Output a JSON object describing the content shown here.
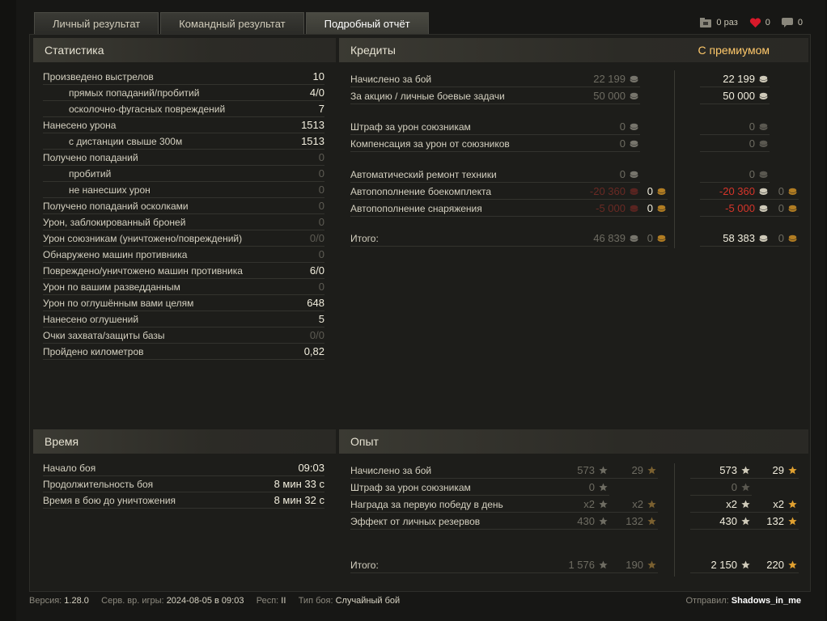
{
  "tabs": [
    "Личный результат",
    "Командный результат",
    "Подробный отчёт"
  ],
  "top": {
    "views": "0 раз",
    "likes": "0",
    "comments": "0"
  },
  "stats": {
    "title": "Статистика",
    "rows": [
      {
        "label": "Произведено выстрелов",
        "value": "10",
        "indent": false,
        "dim": false
      },
      {
        "label": "прямых попаданий/пробитий",
        "value": "4/0",
        "indent": true,
        "dim": false
      },
      {
        "label": "осколочно-фугасных повреждений",
        "value": "7",
        "indent": true,
        "dim": false
      },
      {
        "label": "Нанесено урона",
        "value": "1513",
        "indent": false,
        "dim": false
      },
      {
        "label": "с дистанции свыше 300м",
        "value": "1513",
        "indent": true,
        "dim": false
      },
      {
        "label": "Получено попаданий",
        "value": "0",
        "indent": false,
        "dim": true
      },
      {
        "label": "пробитий",
        "value": "0",
        "indent": true,
        "dim": true
      },
      {
        "label": "не нанесших урон",
        "value": "0",
        "indent": true,
        "dim": true
      },
      {
        "label": "Получено попаданий осколками",
        "value": "0",
        "indent": false,
        "dim": true
      },
      {
        "label": "Урон, заблокированный броней",
        "value": "0",
        "indent": false,
        "dim": true
      },
      {
        "label": "Урон союзникам (уничтожено/повреждений)",
        "value": "0/0",
        "indent": false,
        "dim": true
      },
      {
        "label": "Обнаружено машин противника",
        "value": "0",
        "indent": false,
        "dim": true
      },
      {
        "label": "Повреждено/уничтожено машин противника",
        "value": "6/0",
        "indent": false,
        "dim": false
      },
      {
        "label": "Урон по вашим разведданным",
        "value": "0",
        "indent": false,
        "dim": true
      },
      {
        "label": "Урон по оглушённым вами целям",
        "value": "648",
        "indent": false,
        "dim": false
      },
      {
        "label": "Нанесено оглушений",
        "value": "5",
        "indent": false,
        "dim": false
      },
      {
        "label": "Очки захвата/защиты базы",
        "value": "0/0",
        "indent": false,
        "dim": true
      },
      {
        "label": "Пройдено километров",
        "value": "0,82",
        "indent": false,
        "dim": false
      }
    ]
  },
  "credits": {
    "title": "Кредиты",
    "premium_label": "С премиумом",
    "rows": [
      {
        "label": "Начислено за бой",
        "base": "22 199",
        "base_gold": "",
        "prem": "22 199",
        "prem_gold": "",
        "kind": "normal"
      },
      {
        "label": "За акцию / личные боевые задачи",
        "base": "50 000",
        "base_gold": "",
        "prem": "50 000",
        "prem_gold": "",
        "kind": "normal"
      },
      {
        "label": "Штраф за урон союзникам",
        "base": "0",
        "base_gold": "",
        "prem": "0",
        "prem_gold": "",
        "kind": "zero"
      },
      {
        "label": "Компенсация за урон от союзников",
        "base": "0",
        "base_gold": "",
        "prem": "0",
        "prem_gold": "",
        "kind": "zero"
      },
      {
        "label": "Автоматический ремонт техники",
        "base": "0",
        "base_gold": "",
        "prem": "0",
        "prem_gold": "",
        "kind": "zero"
      },
      {
        "label": "Автопополнение боекомплекта",
        "base": "-20 360",
        "base_gold": "0",
        "prem": "-20 360",
        "prem_gold": "0",
        "kind": "neg"
      },
      {
        "label": "Автопополнение снаряжения",
        "base": "-5 000",
        "base_gold": "0",
        "prem": "-5 000",
        "prem_gold": "0",
        "kind": "neg"
      },
      {
        "label": "Итого:",
        "base": "46 839",
        "base_gold": "0",
        "prem": "58 383",
        "prem_gold": "0",
        "kind": "total"
      }
    ]
  },
  "time": {
    "title": "Время",
    "rows": [
      {
        "label": "Начало боя",
        "value": "09:03"
      },
      {
        "label": "Продолжительность боя",
        "value": "8 мин 33 с"
      },
      {
        "label": "Время в бою до уничтожения",
        "value": "8 мин 32 с"
      }
    ]
  },
  "xp": {
    "title": "Опыт",
    "rows": [
      {
        "label": "Начислено за бой",
        "base": "573",
        "base_free": "29",
        "prem": "573",
        "prem_free": "29"
      },
      {
        "label": "Штраф за урон союзникам",
        "base": "0",
        "base_free": "",
        "prem": "0",
        "prem_free": ""
      },
      {
        "label": "Награда за первую победу в день",
        "base": "x2",
        "base_free": "x2",
        "prem": "x2",
        "prem_free": "x2"
      },
      {
        "label": "Эффект от личных резервов",
        "base": "430",
        "base_free": "132",
        "prem": "430",
        "prem_free": "132"
      },
      {
        "label": "Итого:",
        "base": "1 576",
        "base_free": "190",
        "prem": "2 150",
        "prem_free": "220"
      }
    ]
  },
  "footer": {
    "version_label": "Версия:",
    "version": "1.28.0",
    "server_label": "Серв. вр. игры:",
    "server": "2024-08-05 в 09:03",
    "region_label": "Респ:",
    "region": "II",
    "battle_label": "Тип боя:",
    "battle": "Случайный бой",
    "sender_label": "Отправил:",
    "sender": "Shadows_in_me"
  },
  "colors": {
    "premium": "#ffc96b",
    "negative": "#d6352a",
    "accent_gold": "#e0a030"
  }
}
